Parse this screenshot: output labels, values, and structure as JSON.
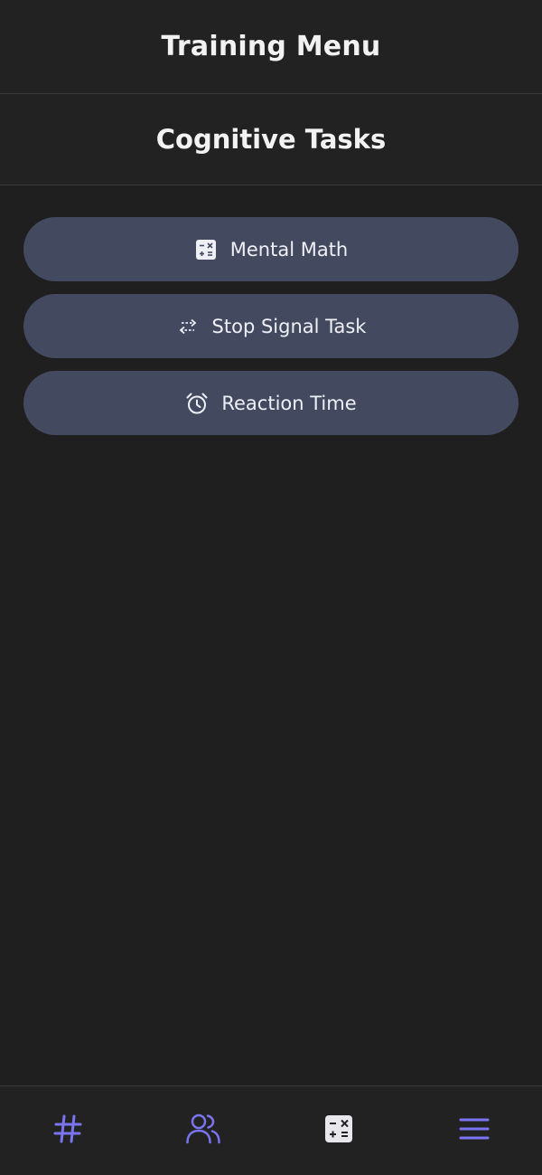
{
  "header": {
    "title": "Training Menu"
  },
  "section": {
    "title": "Cognitive Tasks"
  },
  "menu": {
    "items": [
      {
        "label": "Mental Math",
        "icon": "calculator-icon"
      },
      {
        "label": "Stop Signal Task",
        "icon": "swap-arrows-icon"
      },
      {
        "label": "Reaction Time",
        "icon": "alarm-clock-icon"
      }
    ]
  },
  "bottom_nav": {
    "items": [
      {
        "icon": "hashtag-icon"
      },
      {
        "icon": "users-icon"
      },
      {
        "icon": "calculator-icon"
      },
      {
        "icon": "menu-icon"
      }
    ]
  },
  "colors": {
    "background": "#1f1f1f",
    "header_background": "#222222",
    "button_background": "#434a60",
    "accent": "#7b74f0",
    "text": "#f2f2f2"
  }
}
